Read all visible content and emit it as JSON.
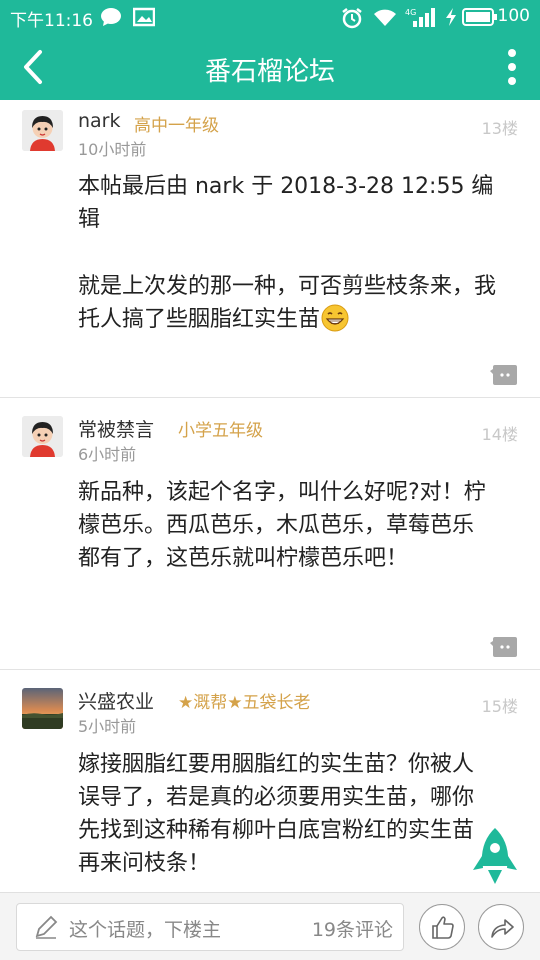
{
  "status_bar": {
    "time": "下午11:16",
    "network": "4G",
    "battery": "100"
  },
  "header": {
    "title": "番石榴论坛",
    "back_icon": "back-arrow-icon",
    "menu_icon": "more-vertical-icon"
  },
  "posts": [
    {
      "username": "nark",
      "rank": "高中一年级",
      "time": "10小时前",
      "floor": "13楼",
      "content_line1": " 本帖最后由 nark 于 2018-3-28 12:55 编辑",
      "content_line2": "就是上次发的那一种，可否剪些枝条来，我托人搞了些胭脂红实生苗"
    },
    {
      "username": "常被禁言",
      "rank": "小学五年级",
      "time": "6小时前",
      "floor": "14楼",
      "content": "新品种，该起个名字，叫什么好呢?对！柠檬芭乐。西瓜芭乐，木瓜芭乐，草莓芭乐都有了，这芭乐就叫柠檬芭乐吧！"
    },
    {
      "username": "兴盛农业",
      "rank": "★溉帮★五袋长老",
      "time": "5小时前",
      "floor": "15楼",
      "content": "嫁接胭脂红要用胭脂红的实生苗？你被人误导了，若是真的必须要用实生苗，哪你先找到这种稀有柳叶白底宫粉红的实生苗再来问枝条！"
    }
  ],
  "bottom_bar": {
    "placeholder": "这个话题，下楼主",
    "comment_count": "19条评论",
    "like_icon": "thumbs-up-icon",
    "share_icon": "share-icon"
  },
  "colors": {
    "brand": "#1fb99a",
    "rank": "#d4a24a"
  }
}
